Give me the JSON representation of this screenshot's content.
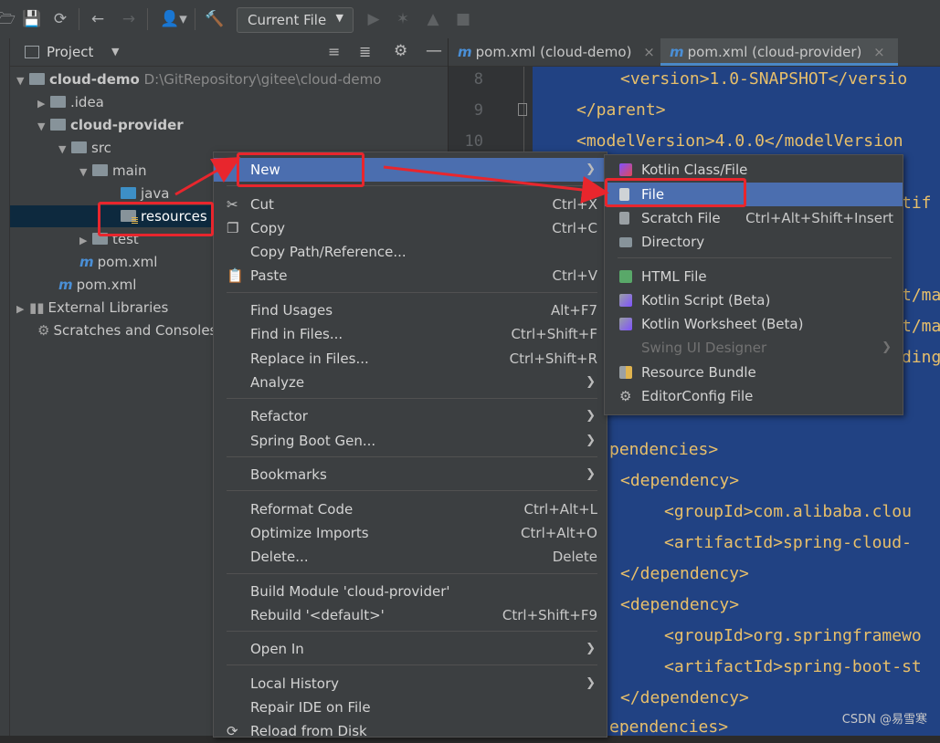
{
  "toolbar": {
    "run_config": "Current File",
    "icons": [
      "open-folder-icon",
      "save-icon",
      "sync-icon",
      "back-icon",
      "forward-icon",
      "user-icon",
      "build-hammer-icon",
      "run-icon",
      "debug-icon",
      "coverage-icon",
      "stop-icon"
    ]
  },
  "project": {
    "header_title": "Project",
    "tree": [
      {
        "label": "cloud-demo",
        "path": "D:\\GitRepository\\gitee\\cloud-demo"
      },
      {
        "label": ".idea"
      },
      {
        "label": "cloud-provider"
      },
      {
        "label": "src"
      },
      {
        "label": "main"
      },
      {
        "label": "java"
      },
      {
        "label": "resources"
      },
      {
        "label": "test"
      },
      {
        "label": "pom.xml"
      },
      {
        "label": "pom.xml"
      },
      {
        "label": "External Libraries"
      },
      {
        "label": "Scratches and Consoles"
      }
    ]
  },
  "editor": {
    "tabs": [
      {
        "label": "pom.xml (cloud-demo)"
      },
      {
        "label": "pom.xml (cloud-provider)"
      }
    ],
    "line_numbers": [
      "8",
      "9",
      "10"
    ],
    "lines": [
      "<version>1.0-SNAPSHOT</versio",
      "</parent>",
      "<modelVersion>4.0.0</modelVersion",
      "tif",
      "t/ma",
      "t/ma",
      "ding",
      "pendencies>",
      "<dependency>",
      "<groupId>com.alibaba.clou",
      "<artifactId>spring-cloud-",
      "</dependency>",
      "<dependency>",
      "<groupId>org.springframewo",
      "<artifactId>spring-boot-st",
      "</dependency>",
      "ependencies>"
    ]
  },
  "context_menu": {
    "items": [
      {
        "label": "New",
        "shortcut": "",
        "submenu": true
      },
      {
        "label": "Cut",
        "shortcut": "Ctrl+X"
      },
      {
        "label": "Copy",
        "shortcut": "Ctrl+C"
      },
      {
        "label": "Copy Path/Reference...",
        "shortcut": ""
      },
      {
        "label": "Paste",
        "shortcut": "Ctrl+V"
      },
      {
        "label": "Find Usages",
        "shortcut": "Alt+F7"
      },
      {
        "label": "Find in Files...",
        "shortcut": "Ctrl+Shift+F"
      },
      {
        "label": "Replace in Files...",
        "shortcut": "Ctrl+Shift+R"
      },
      {
        "label": "Analyze",
        "shortcut": "",
        "submenu": true
      },
      {
        "label": "Refactor",
        "shortcut": "",
        "submenu": true
      },
      {
        "label": "Spring Boot Gen...",
        "shortcut": "",
        "submenu": true
      },
      {
        "label": "Bookmarks",
        "shortcut": "",
        "submenu": true
      },
      {
        "label": "Reformat Code",
        "shortcut": "Ctrl+Alt+L"
      },
      {
        "label": "Optimize Imports",
        "shortcut": "Ctrl+Alt+O"
      },
      {
        "label": "Delete...",
        "shortcut": "Delete"
      },
      {
        "label": "Build Module 'cloud-provider'",
        "shortcut": ""
      },
      {
        "label": "Rebuild '<default>'",
        "shortcut": "Ctrl+Shift+F9"
      },
      {
        "label": "Open In",
        "shortcut": "",
        "submenu": true
      },
      {
        "label": "Local History",
        "shortcut": "",
        "submenu": true
      },
      {
        "label": "Repair IDE on File",
        "shortcut": ""
      },
      {
        "label": "Reload from Disk",
        "shortcut": ""
      }
    ]
  },
  "submenu": {
    "items": [
      {
        "label": "Kotlin Class/File",
        "shortcut": ""
      },
      {
        "label": "File",
        "shortcut": ""
      },
      {
        "label": "Scratch File",
        "shortcut": "Ctrl+Alt+Shift+Insert"
      },
      {
        "label": "Directory",
        "shortcut": ""
      },
      {
        "label": "HTML File",
        "shortcut": ""
      },
      {
        "label": "Kotlin Script (Beta)",
        "shortcut": ""
      },
      {
        "label": "Kotlin Worksheet (Beta)",
        "shortcut": ""
      },
      {
        "label": "Swing UI Designer",
        "shortcut": ""
      },
      {
        "label": "Resource Bundle",
        "shortcut": ""
      },
      {
        "label": "EditorConfig File",
        "shortcut": ""
      }
    ]
  },
  "watermark": "CSDN @易雪寒",
  "colors": {
    "highlight": "#4b6eaf",
    "annotation_red": "#e8262d",
    "editor_selection": "#214283",
    "xml_tag": "#e8bf6a"
  }
}
